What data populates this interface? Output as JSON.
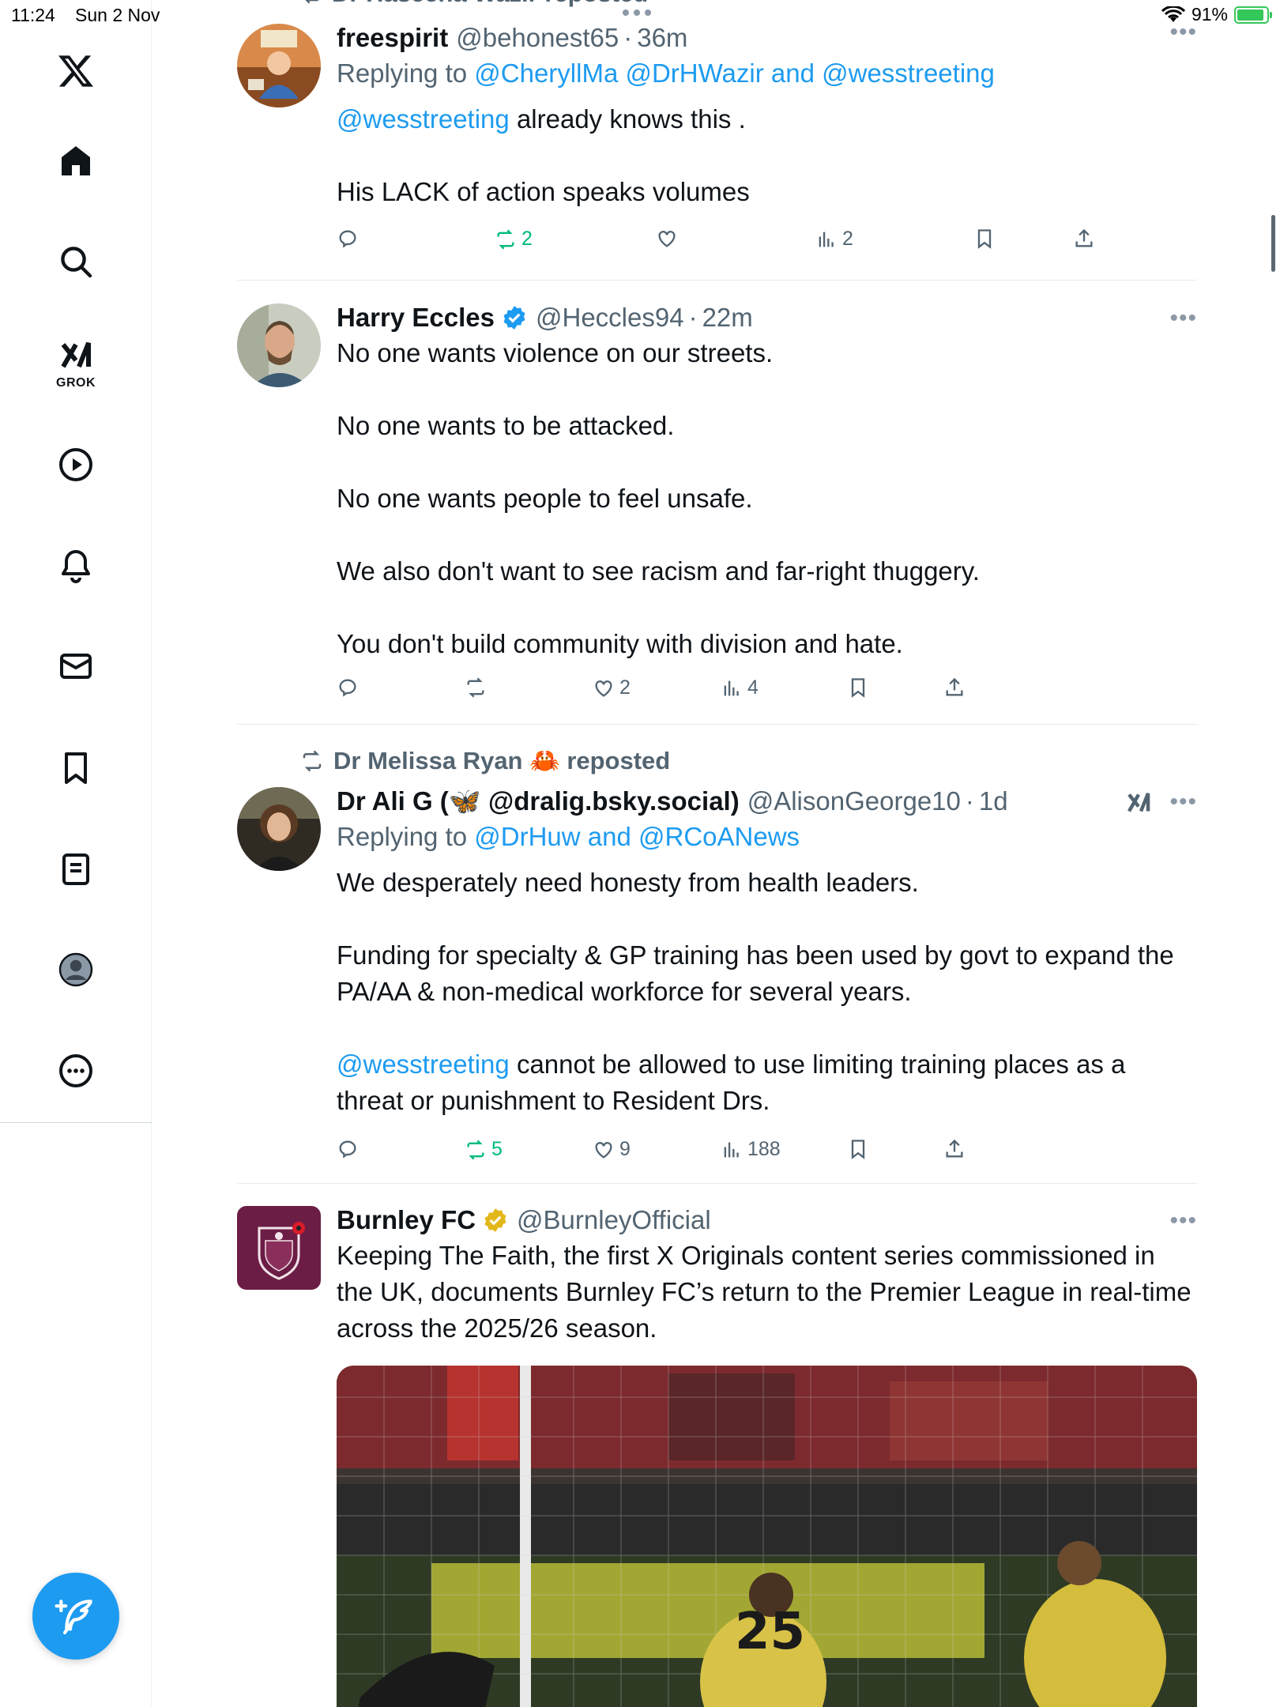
{
  "status": {
    "time": "11:24",
    "date": "Sun 2 Nov",
    "battery": "91%",
    "battery_level": 0.91
  },
  "sidebar": {
    "items": [
      {
        "name": "x-logo",
        "label": "X"
      },
      {
        "name": "home",
        "label": "Home"
      },
      {
        "name": "search",
        "label": "Search"
      },
      {
        "name": "grok",
        "label": "GROK"
      },
      {
        "name": "video",
        "label": "Video"
      },
      {
        "name": "notifications",
        "label": "Notifications"
      },
      {
        "name": "messages",
        "label": "Messages"
      },
      {
        "name": "bookmarks",
        "label": "Bookmarks"
      },
      {
        "name": "lists",
        "label": "Lists"
      },
      {
        "name": "profile",
        "label": "Profile"
      },
      {
        "name": "more",
        "label": "More"
      }
    ],
    "grok_label": "GROK",
    "compose_label": "Post"
  },
  "feed": {
    "top_context": "Dr Haseena Wazir reposted",
    "tweets": [
      {
        "name": "freespirit",
        "handle": "@behonest65",
        "time": "36m",
        "reply_prefix": "Replying to ",
        "reply_to": "@CheryllMa @DrHWazir and @wesstreeting",
        "mention": "@wesstreeting",
        "lines": [
          "already knows this .",
          "His LACK of action speaks volumes"
        ],
        "reposts": "2",
        "views": "2"
      },
      {
        "name": "Harry Eccles",
        "handle": "@Heccles94",
        "time": "22m",
        "lines": [
          "No one wants violence on our streets.",
          "No one wants to be attacked.",
          "No one wants people to feel unsafe.",
          "We also don't want to see racism and far-right thuggery.",
          "You don't build community with division and hate."
        ],
        "likes": "2",
        "views": "4"
      },
      {
        "repost_context": "Dr Melissa Ryan 🦀 reposted",
        "name_prefix": "Dr Ali G (",
        "name_emoji": "🦋",
        "name_suffix": " @dralig.bsky.social)",
        "handle": "@AlisonGeorge10",
        "time": "1d",
        "reply_prefix": "Replying to ",
        "reply_to": "@DrHuw and @RCoANews",
        "para1": "We desperately need honesty from health leaders.",
        "para2": "Funding for specialty & GP training has been used by govt to expand the PA/AA & non-medical workforce for several years.",
        "mention": "@wesstreeting",
        "para3": "cannot be allowed to use limiting training places as a threat or punishment to Resident Drs.",
        "reposts": "5",
        "likes": "9",
        "views": "188"
      },
      {
        "name": "Burnley FC",
        "handle": "@BurnleyOfficial",
        "text": "Keeping The Faith, the first X Originals content series commissioned in the UK, documents Burnley FC’s return to the Premier League in real-time across the 2025/26 season.",
        "shirt_number": "25"
      }
    ]
  },
  "colors": {
    "accent": "#1d9bf0",
    "repost_green": "#00ba7c",
    "secondary_text": "#536471",
    "burnley_claret": "#6c1d45",
    "gold_badge": "#e2b719"
  },
  "icons": [
    "x-logo-icon",
    "home-icon",
    "search-icon",
    "grok-icon",
    "play-icon",
    "bell-icon",
    "mail-icon",
    "bookmark-icon",
    "list-icon",
    "profile-icon",
    "more-icon",
    "compose-icon",
    "reply-icon",
    "repost-icon",
    "like-icon",
    "views-icon",
    "share-icon",
    "verified-icon",
    "wifi-icon",
    "battery-icon"
  ]
}
